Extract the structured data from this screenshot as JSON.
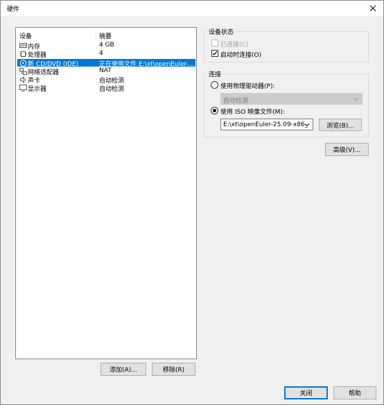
{
  "window": {
    "title": "硬件"
  },
  "device_list": {
    "col_device": "设备",
    "col_summary": "摘要",
    "rows": [
      {
        "icon": "memory-icon",
        "name": "内存",
        "summary": "4 GB"
      },
      {
        "icon": "processor-icon",
        "name": "处理器",
        "summary": "4"
      },
      {
        "icon": "cd-dvd-icon",
        "name": "新 CD/DVD (IDE)",
        "summary": "正在使用文件 E:\\xt\\openEuler-...",
        "selected": true
      },
      {
        "icon": "network-adapter-icon",
        "name": "网络适配器",
        "summary": "NAT"
      },
      {
        "icon": "sound-card-icon",
        "name": "声卡",
        "summary": "自动检测"
      },
      {
        "icon": "display-icon",
        "name": "显示器",
        "summary": "自动检测"
      }
    ]
  },
  "buttons": {
    "add": "添加(A)...",
    "remove": "移除(R)",
    "close": "关闭",
    "help": "帮助",
    "advanced": "高级(V)...",
    "browse": "浏览(B)..."
  },
  "device_status": {
    "group_label": "设备状态",
    "connected_label": "已连接(C)",
    "connect_on_power_on_label": "启动时连接(O)",
    "connected_checked": false,
    "connect_on_power_on_checked": true
  },
  "connection": {
    "group_label": "连接",
    "physical_drive_label": "使用物理驱动器(P):",
    "physical_drive_value": "自动检测",
    "iso_label": "使用 ISO 映像文件(M):",
    "iso_path": "E:\\xt\\openEuler-25.09-x86_"
  },
  "colors": {
    "selection": "#0078d7",
    "window_bg": "#f0f0f0"
  }
}
